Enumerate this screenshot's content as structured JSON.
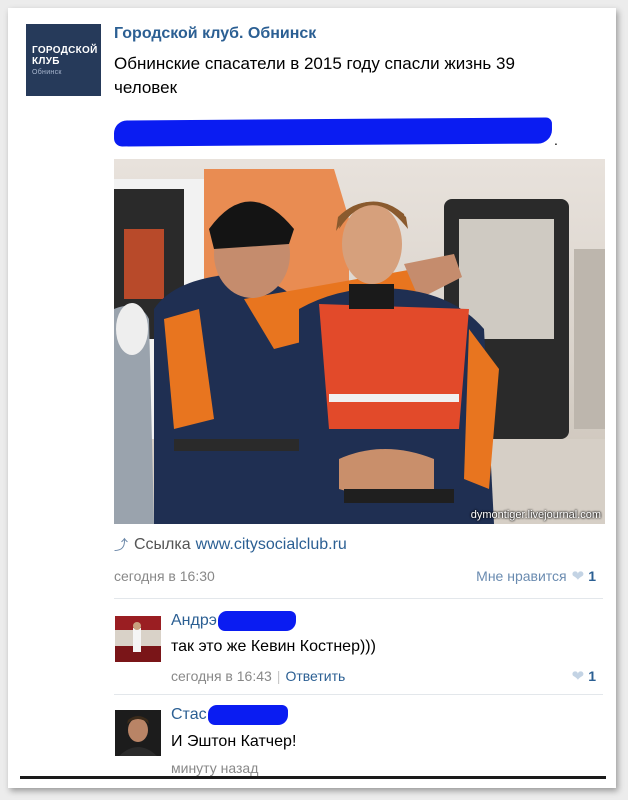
{
  "post": {
    "group_name": "Городской клуб. Обнинск",
    "avatar_title": "ГОРОДСКОЙ КЛУБ",
    "avatar_subtitle": "Обнинск",
    "text": "Обнинские спасатели в 2015 году спасли жизнь 39 человек",
    "redacted_suffix": ".",
    "watermark": "dymontiger.livejournal.com",
    "link_label": "Ссылка",
    "link_url": "www.citysocialclub.ru",
    "link_icon": "link-arrow-icon",
    "time": "сегодня в 16:30",
    "like_label": "Мне нравится",
    "like_count": "1",
    "like_icon": "heart-icon"
  },
  "comments": [
    {
      "author": "Андрэ",
      "text": "так это же Кевин Костнер)))",
      "time": "сегодня в 16:43",
      "reply_label": "Ответить",
      "like_count": "1"
    },
    {
      "author": "Стас",
      "text": "И Эштон Катчер!",
      "time": "минуту назад"
    }
  ],
  "colors": {
    "link": "#2b5f93",
    "redaction": "#0a1cf2",
    "meta": "#888888",
    "heart": "#c3d3e4"
  }
}
